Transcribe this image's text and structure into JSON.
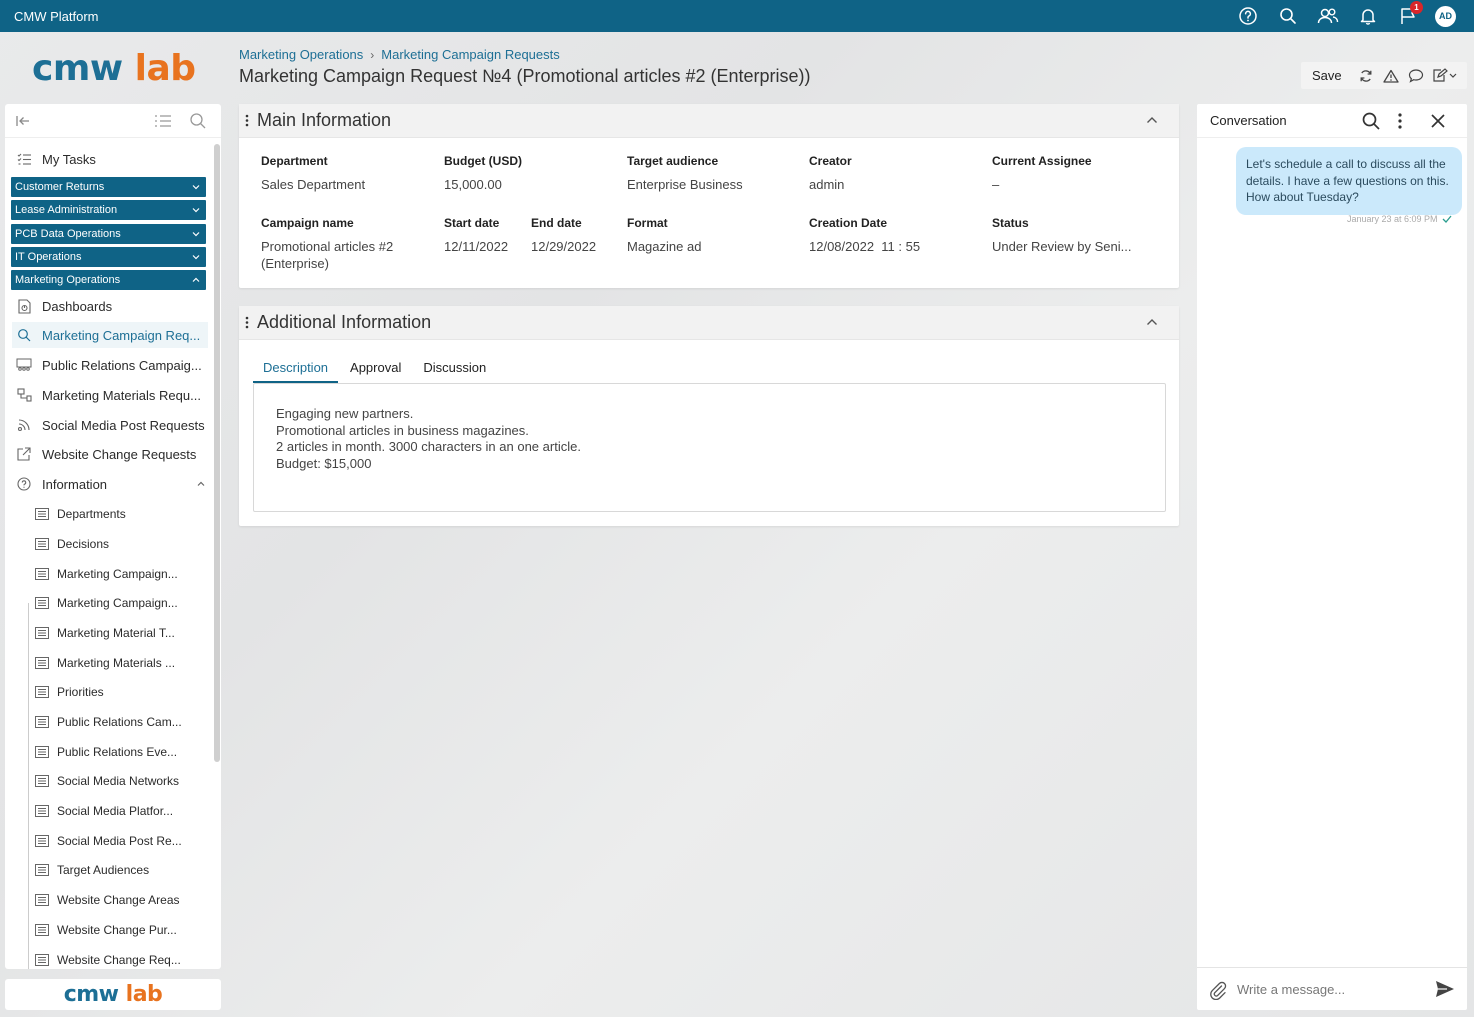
{
  "app": {
    "title": "CMW Platform",
    "notification_count": "1",
    "avatar_initials": "AD"
  },
  "logo": {
    "part1": "cmw",
    "part2": "lab"
  },
  "breadcrumb": {
    "items": [
      "Marketing Operations",
      "Marketing Campaign Requests"
    ]
  },
  "page": {
    "title": "Marketing Campaign Request №4 (Promotional articles #2 (Enterprise))"
  },
  "toolbar": {
    "save_label": "Save"
  },
  "sidebar": {
    "my_tasks": "My Tasks",
    "groups": [
      "Customer Returns",
      "Lease Administration",
      "PCB Data Operations",
      "IT Operations",
      "Marketing Operations"
    ],
    "items": [
      {
        "label": "Dashboards",
        "icon": "dashboard-icon"
      },
      {
        "label": "Marketing Campaign Req...",
        "icon": "search-doc-icon",
        "active": true
      },
      {
        "label": "Public Relations Campaig...",
        "icon": "people-icon"
      },
      {
        "label": "Marketing Materials Requ...",
        "icon": "materials-icon"
      },
      {
        "label": "Social Media Post Requests",
        "icon": "broadcast-icon"
      },
      {
        "label": "Website Change Requests",
        "icon": "external-link-icon"
      },
      {
        "label": "Information",
        "icon": "help-circle-icon"
      }
    ],
    "sub_items": [
      "Departments",
      "Decisions",
      "Marketing Campaign...",
      "Marketing Campaign...",
      "Marketing Material T...",
      "Marketing Materials ...",
      "Priorities",
      "Public Relations Cam...",
      "Public Relations Eve...",
      "Social Media Networks",
      "Social Media Platfor...",
      "Social Media Post Re...",
      "Target Audiences",
      "Website Change Areas",
      "Website Change Pur...",
      "Website Change Req..."
    ]
  },
  "main_info": {
    "title": "Main Information",
    "fields": {
      "department": {
        "label": "Department",
        "value": "Sales Department"
      },
      "budget": {
        "label": "Budget (USD)",
        "value": "15,000.00"
      },
      "target_audience": {
        "label": "Target audience",
        "value": "Enterprise Business"
      },
      "creator": {
        "label": "Creator",
        "value": "admin"
      },
      "assignee": {
        "label": "Current Assignee",
        "value": "–"
      },
      "campaign_name": {
        "label": "Campaign name",
        "value_line1": "Promotional articles #2",
        "value_line2": "(Enterprise)"
      },
      "start_date": {
        "label": "Start date",
        "value": "12/11/2022"
      },
      "end_date": {
        "label": "End date",
        "value": "12/29/2022"
      },
      "format": {
        "label": "Format",
        "value": "Magazine ad"
      },
      "creation_date": {
        "label": "Creation Date",
        "value": "12/08/2022  11 : 55"
      },
      "status": {
        "label": "Status",
        "value": "Under Review by Seni..."
      }
    }
  },
  "additional_info": {
    "title": "Additional Information",
    "tabs": [
      "Description",
      "Approval",
      "Discussion"
    ],
    "description_lines": [
      "Engaging new partners.",
      "Promotional articles in business magazines.",
      "2 articles in month. 3000 characters in an one article.",
      "Budget: $15,000"
    ]
  },
  "conversation": {
    "title": "Conversation",
    "message": "Let's schedule a call to discuss all the details. I have a few questions on this. How about Tuesday?",
    "timestamp": "January 23 at 6:09 PM",
    "compose_placeholder": "Write a message..."
  },
  "colors": {
    "header": "#0f6386",
    "accent": "#1d6f95",
    "logo_orange": "#e8731f",
    "bubble": "#cbe9fb"
  }
}
